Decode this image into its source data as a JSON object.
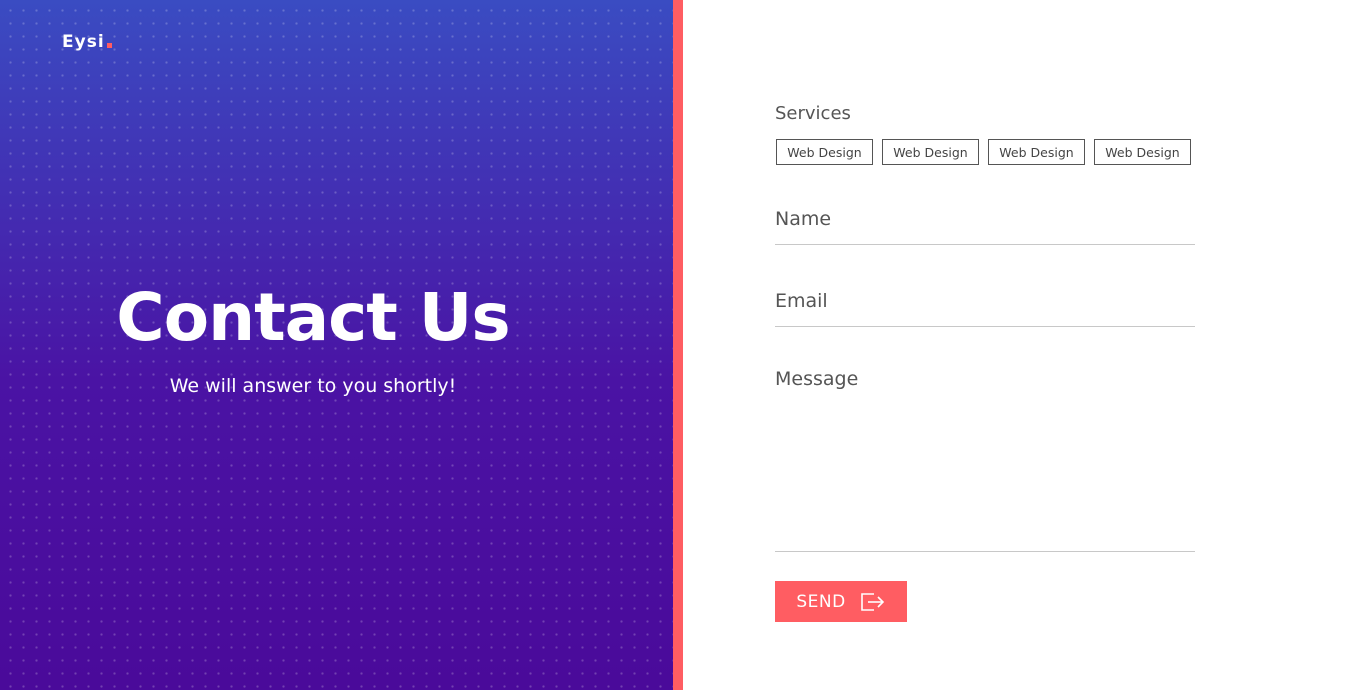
{
  "brand": {
    "logo_text": "Eysi",
    "accent_color": "#ff5d62",
    "hero_gradient_top": "#3a4cc2",
    "hero_gradient_bottom": "#4a0a9a"
  },
  "hero": {
    "title": "Contact Us",
    "subtitle": "We will answer to you shortly!"
  },
  "form": {
    "services_label": "Services",
    "services": [
      {
        "label": "Web Design"
      },
      {
        "label": "Web Design"
      },
      {
        "label": "Web Design"
      },
      {
        "label": "Web Design"
      }
    ],
    "name_label": "Name",
    "email_label": "Email",
    "message_label": "Message",
    "send_label": "SEND",
    "send_icon": "sign-out-arrow-icon"
  }
}
